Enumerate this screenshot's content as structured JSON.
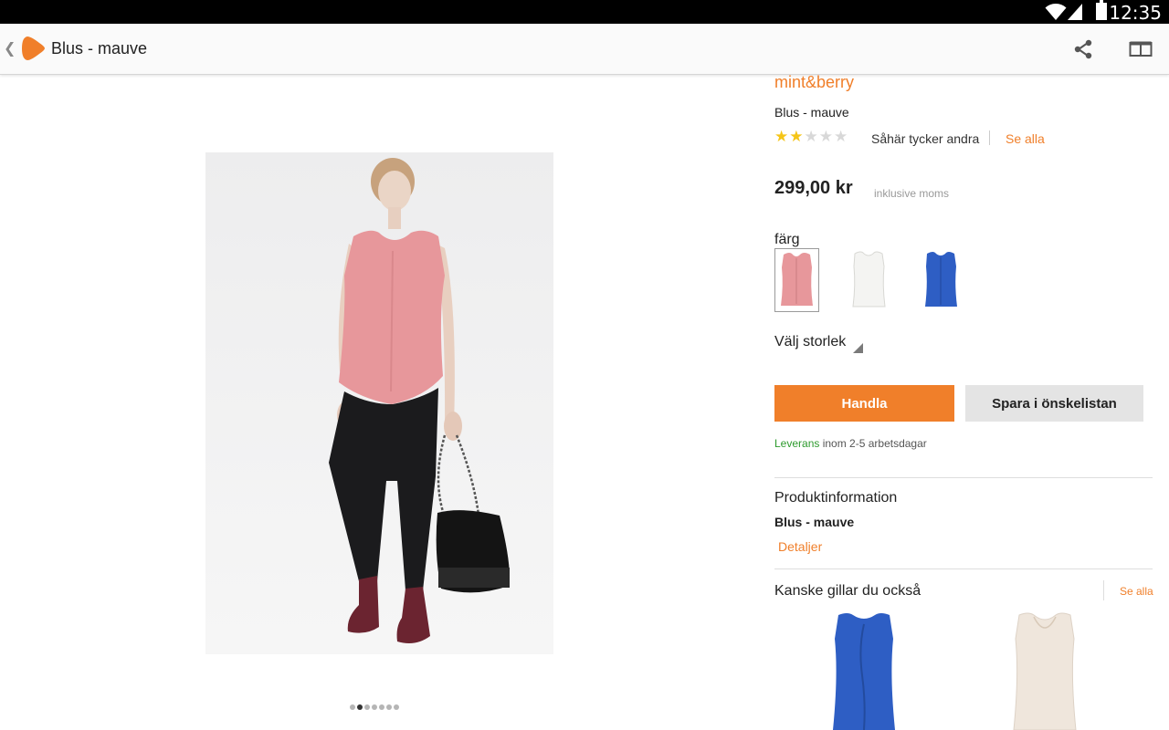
{
  "status_bar": {
    "time": "12:35"
  },
  "header": {
    "title": "Blus - mauve"
  },
  "product": {
    "brand": "mint&berry",
    "name": "Blus - mauve",
    "rating": {
      "value": 2,
      "max": 5
    },
    "reviews_label": "Såhär tycker andra",
    "see_all_reviews": "Se alla",
    "price": "299,00 kr",
    "vat_note": "inklusive moms",
    "image_count": 7,
    "active_image": 2
  },
  "color": {
    "label": "färg",
    "options": [
      "pink",
      "white",
      "blue"
    ],
    "selected": "pink"
  },
  "size": {
    "label": "Välj storlek"
  },
  "actions": {
    "buy_label": "Handla",
    "wishlist_label": "Spara i önskelistan"
  },
  "delivery": {
    "highlight": "Leverans",
    "text": " inom 2-5 arbetsdagar"
  },
  "product_info": {
    "title": "Produktinformation",
    "name": "Blus - mauve",
    "details_link": "Detaljer"
  },
  "recommendations": {
    "title": "Kanske gillar du också",
    "see_all": "Se alla"
  },
  "colors": {
    "accent": "#f07f2a",
    "green": "#2d9a2d",
    "status_bar": "#000000"
  }
}
